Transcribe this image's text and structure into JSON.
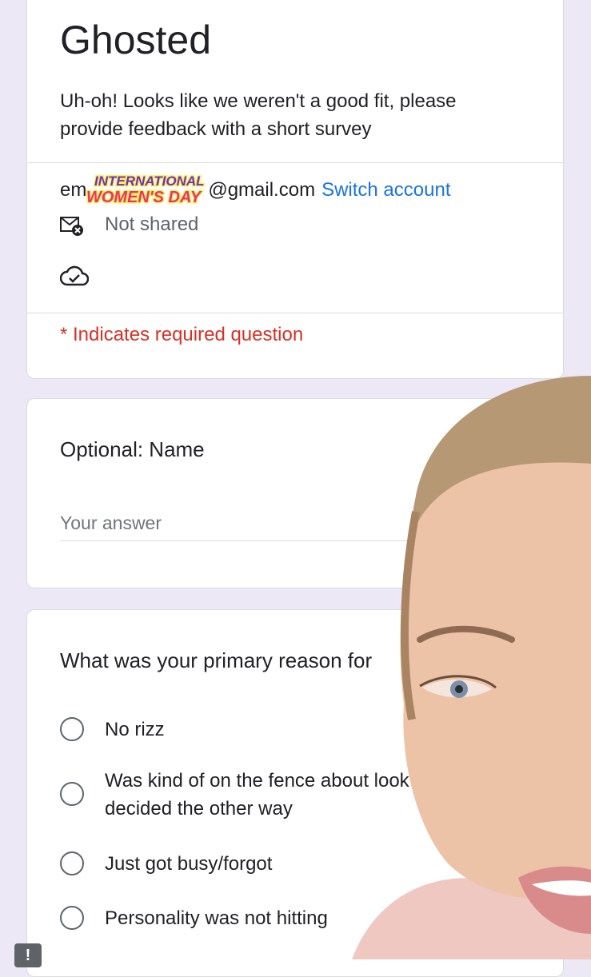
{
  "form": {
    "title": "Ghosted",
    "description": "Uh-oh! Looks like we weren't a good fit, please provide feedback with a short survey",
    "account": {
      "prefix": "em",
      "sticker_line1": "INTERNATIONAL",
      "sticker_line2": "WOMEN'S DAY",
      "email_suffix": "@gmail.com",
      "switch_label": "Switch account"
    },
    "not_shared": "Not shared",
    "required_note": "* Indicates required question"
  },
  "questions": [
    {
      "title": "Optional: Name",
      "placeholder": "Your answer"
    },
    {
      "title": "What was your primary reason for",
      "options": [
        {
          "label": "No rizz"
        },
        {
          "label": "Was kind of on the fence about look decided the other way"
        },
        {
          "label": "Just got busy/forgot"
        },
        {
          "label": "Personality was not hitting"
        }
      ]
    }
  ],
  "badge": "!",
  "colors": {
    "page_bg": "#ece8f6",
    "link": "#1a73e8",
    "required": "#d93025",
    "sticker_purple": "#6b2fd6",
    "sticker_pink": "#e8317a",
    "sticker_yellow": "#fff04a"
  },
  "icons": [
    "mail-blocked-icon",
    "cloud-check-icon",
    "radio-icon",
    "alert-icon"
  ]
}
